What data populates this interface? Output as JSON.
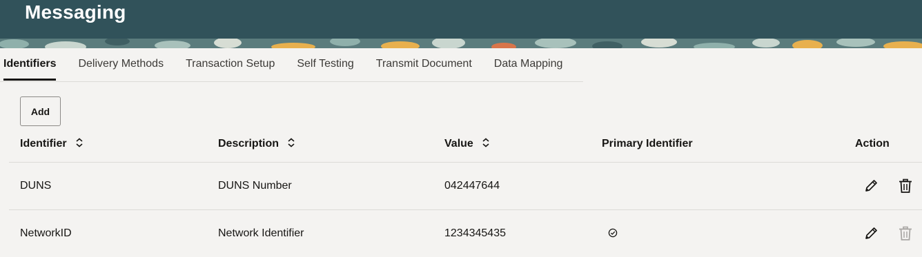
{
  "header": {
    "title": "Messaging",
    "colors": {
      "background": "#31525a",
      "accent": "#e8b04e"
    }
  },
  "tabs": [
    {
      "label": "Identifiers",
      "active": true
    },
    {
      "label": "Delivery Methods",
      "active": false
    },
    {
      "label": "Transaction Setup",
      "active": false
    },
    {
      "label": "Self Testing",
      "active": false
    },
    {
      "label": "Transmit Document",
      "active": false
    },
    {
      "label": "Data Mapping",
      "active": false
    }
  ],
  "toolbar": {
    "add_label": "Add"
  },
  "table": {
    "columns": [
      {
        "label": "Identifier",
        "sortable": true
      },
      {
        "label": "Description",
        "sortable": true
      },
      {
        "label": "Value",
        "sortable": true
      },
      {
        "label": "Primary Identifier",
        "sortable": false
      },
      {
        "label": "Action",
        "sortable": false
      }
    ],
    "rows": [
      {
        "identifier": "DUNS",
        "description": "DUNS Number",
        "value": "042447644",
        "primary": false,
        "delete_enabled": true
      },
      {
        "identifier": "NetworkID",
        "description": "Network Identifier",
        "value": "1234345435",
        "primary": true,
        "delete_enabled": false
      }
    ]
  },
  "icons": {
    "sort": "sort-icon",
    "primary": "check-circle-icon",
    "edit": "pencil-icon",
    "delete": "trash-icon"
  }
}
